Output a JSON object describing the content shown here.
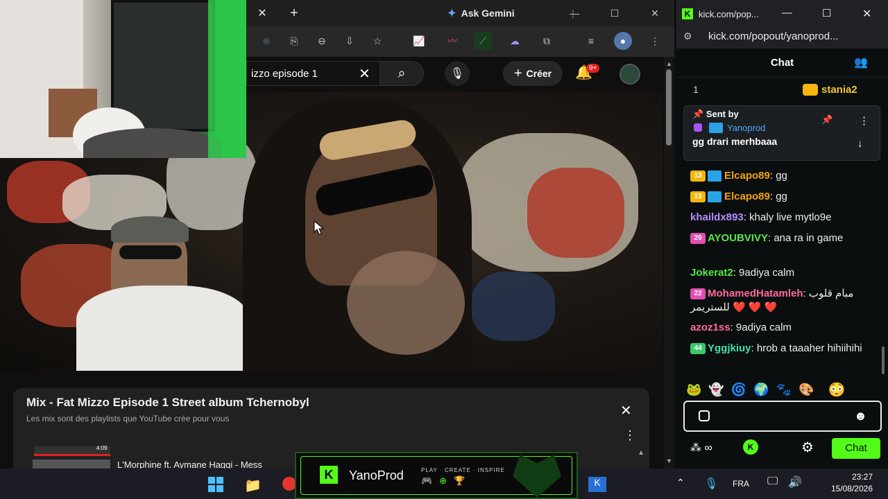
{
  "browser": {
    "ask_gemini": "Ask Gemini",
    "search_query": "izzo episode 1",
    "create_label": "Créer",
    "notif_count": "9+"
  },
  "playlist": {
    "title": "Mix - Fat Mizzo Episode 1 Street album Tchernobyl",
    "subtitle": "Les mix sont des playlists que YouTube crée pour vous",
    "next_item": "L'Morphine ft. Aymane Haggi - Mess",
    "duration": "4:09"
  },
  "kick": {
    "tab_title": "kick.com/pop...",
    "url": "kick.com/popout/yanoprod...",
    "header": "Chat",
    "count": "1",
    "top_user": "stania2",
    "pinned": {
      "sent_by": "Sent by",
      "author": "Yanoprod",
      "message": "gg drari merhbaaa"
    },
    "messages": [
      {
        "badge": "13",
        "badge_color": "#f5b50e",
        "user": "Elcapo89",
        "user_color": "#f2a40c",
        "text": ": gg",
        "blue": true
      },
      {
        "badge": "13",
        "badge_color": "#f5b50e",
        "user": "Elcapo89",
        "user_color": "#f2a40c",
        "text": ": gg",
        "blue": true
      },
      {
        "badge": "",
        "badge_color": "",
        "user": "khaildx893",
        "user_color": "#b48cff",
        "text": ": khaly live mytlo9e",
        "blue": false
      },
      {
        "badge": "20",
        "badge_color": "#e24fb0",
        "user": "AYOUBVIVY",
        "user_color": "#58e848",
        "text": ": ana ra in game",
        "blue": false
      },
      {
        "badge": "",
        "badge_color": "",
        "user": "Jokerat2",
        "user_color": "#58e848",
        "text": ": 9adiya calm",
        "blue": false
      },
      {
        "badge": "22",
        "badge_color": "#e24fb0",
        "user": "MohamedHatamleh",
        "user_color": "#ff6a9a",
        "text": ": مبام قلوب للستريمر ❤️ ❤️ ❤️",
        "blue": false
      },
      {
        "badge": "",
        "badge_color": "",
        "user": "azoz1ss",
        "user_color": "#ff6a9a",
        "text": ": 9adiya calm",
        "blue": false
      },
      {
        "badge": "44",
        "badge_color": "#39c86a",
        "user": "Yggjkiuy",
        "user_color": "#3ee0a7",
        "text": ": hrob a taaaher hihiihihi",
        "blue": false
      }
    ],
    "chat_button": "Chat"
  },
  "banner": {
    "name": "YanoProd",
    "tagline": "PLAY · CREATE · INSPIRE"
  },
  "taskbar": {
    "lang": "FRA",
    "time": "23:27",
    "date": "15/08/2026"
  }
}
